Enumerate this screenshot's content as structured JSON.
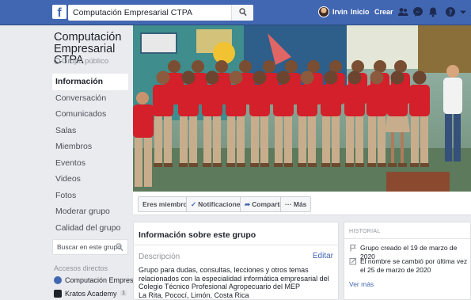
{
  "topbar": {
    "logo": "f",
    "search_value": "Computación Empresarial CTPA",
    "user_name": "Irvin",
    "nav_home": "Inicio",
    "nav_create": "Crear",
    "icons": [
      "friends-icon",
      "messenger-icon",
      "notifications-icon",
      "help-icon",
      "account-menu-icon"
    ]
  },
  "group": {
    "name": "Computación Empresarial CTPA",
    "type": "Grupo público"
  },
  "sidebar": {
    "items": [
      {
        "label": "Información",
        "active": true
      },
      {
        "label": "Conversación"
      },
      {
        "label": "Comunicados"
      },
      {
        "label": "Salas"
      },
      {
        "label": "Miembros"
      },
      {
        "label": "Eventos"
      },
      {
        "label": "Videos"
      },
      {
        "label": "Fotos"
      },
      {
        "label": "Moderar grupo"
      },
      {
        "label": "Calidad del grupo"
      }
    ],
    "search_placeholder": "Buscar en este grupo",
    "shortcuts_title": "Accesos directos",
    "shortcuts": [
      {
        "label": "Computación Empresar...",
        "color": "#4267b2"
      },
      {
        "label": "Kratos Academy",
        "color": "#1d2129",
        "count": "1"
      }
    ]
  },
  "actions": {
    "member": "Eres miembro",
    "notifications": "Notificaciones",
    "share": "Compartir",
    "more": "Más"
  },
  "about": {
    "title": "Información sobre este grupo",
    "desc_label": "Descripción",
    "edit": "Editar",
    "desc_1": "Grupo para dudas, consultas, lecciones y otros temas relacionados con la especialidad informática empresarial del Colegio Técnico Profesional Agropecuario del MEP",
    "desc_2": "La Rita, Pococí, Limón, Costa Rica"
  },
  "history": {
    "title": "HISTORIAL",
    "item_1": "Grupo creado el 19 de marzo de 2020",
    "item_2": "El nombre se cambió por última vez el 25 de marzo de 2020",
    "more": "Ver más"
  },
  "colors": {
    "brand": "#4267b2",
    "shirt": "#d3202a",
    "pants": "#c8ad8c"
  }
}
